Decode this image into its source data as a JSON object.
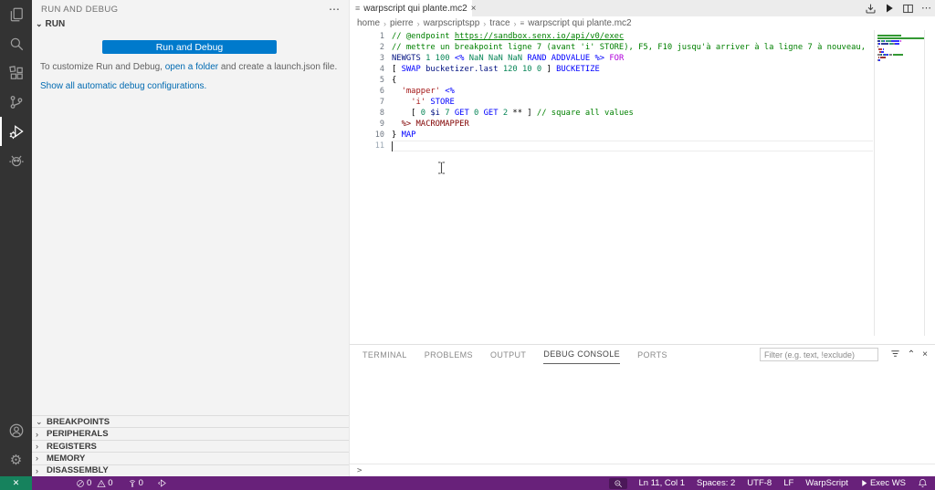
{
  "colors": {
    "accent": "#007acc",
    "statusbar": "#68217a",
    "remote": "#16825d",
    "comment": "#008000",
    "keyword": "#0000ff",
    "control": "#af00db",
    "variable": "#001080",
    "number": "#098658",
    "string": "#a31515",
    "macro": "#800000",
    "default": "#000000"
  },
  "icons": {
    "more": "⋯",
    "close": "×",
    "chevron_down": "⌄",
    "chevron_right": "›",
    "breadcrumb_sep": "›",
    "file": "≡",
    "collapse_up": "⌃",
    "remote": "✕",
    "gear": "⚙"
  },
  "activity_bar": {
    "items": [
      "explorer",
      "search",
      "extensions",
      "source-control",
      "run-and-debug",
      "debug-alt"
    ],
    "active": "run-and-debug",
    "bottom_items": [
      "accounts",
      "settings"
    ]
  },
  "sidebar": {
    "title": "RUN AND DEBUG",
    "run_label": "RUN",
    "button_label": "Run and Debug",
    "customize_pre": "To customize Run and Debug, ",
    "open_folder_link": "open a folder",
    "customize_post": " and create a launch.json file.",
    "show_configs_link": "Show all automatic debug configurations.",
    "sections": [
      "BREAKPOINTS",
      "PERIPHERALS",
      "REGISTERS",
      "MEMORY",
      "DISASSEMBLY"
    ]
  },
  "editor": {
    "tab": {
      "label": "warpscript qui plante.mc2"
    },
    "breadcrumb": [
      "home",
      "pierre",
      "warpscriptspp",
      "trace",
      "warpscript qui plante.mc2"
    ],
    "actions": [
      "run-or-debug",
      "run",
      "split-editor",
      "more-actions"
    ],
    "cursor": {
      "line": 11,
      "col": 1
    },
    "lines": [
      [
        [
          "c",
          "// @endpoint "
        ],
        [
          "cu",
          "https://sandbox.senx.io/api/v0/exec"
        ]
      ],
      [
        [
          "c",
          "// mettre un breakpoint ligne 7 (avant 'i' STORE), F5, F10 jusqu'à arriver à la ligne 7 à nouveau,"
        ]
      ],
      [
        [
          "v",
          "NEWGTS"
        ],
        [
          "d",
          " "
        ],
        [
          "n",
          "1 100"
        ],
        [
          "d",
          " "
        ],
        [
          "k",
          "<%"
        ],
        [
          "d",
          " "
        ],
        [
          "n",
          "NaN NaN NaN"
        ],
        [
          "d",
          " "
        ],
        [
          "k",
          "RAND ADDVALUE"
        ],
        [
          "d",
          " "
        ],
        [
          "k",
          "%>"
        ],
        [
          "d",
          " "
        ],
        [
          "f",
          "FOR"
        ]
      ],
      [
        [
          "d",
          "[ "
        ],
        [
          "k",
          "SWAP"
        ],
        [
          "d",
          " "
        ],
        [
          "v",
          "bucketizer.last"
        ],
        [
          "d",
          " "
        ],
        [
          "n",
          "120 10 0"
        ],
        [
          "d",
          " ] "
        ],
        [
          "k",
          "BUCKETIZE"
        ]
      ],
      [
        [
          "d",
          "{"
        ]
      ],
      [
        [
          "d",
          "  "
        ],
        [
          "s",
          "'mapper'"
        ],
        [
          "d",
          " "
        ],
        [
          "k",
          "<%"
        ]
      ],
      [
        [
          "d",
          "    "
        ],
        [
          "s",
          "'i'"
        ],
        [
          "d",
          " "
        ],
        [
          "k",
          "STORE"
        ]
      ],
      [
        [
          "d",
          "    [ "
        ],
        [
          "n",
          "0"
        ],
        [
          "d",
          " "
        ],
        [
          "v",
          "$i"
        ],
        [
          "d",
          " "
        ],
        [
          "n",
          "7"
        ],
        [
          "d",
          " "
        ],
        [
          "k",
          "GET"
        ],
        [
          "d",
          " "
        ],
        [
          "n",
          "0"
        ],
        [
          "d",
          " "
        ],
        [
          "k",
          "GET"
        ],
        [
          "d",
          " "
        ],
        [
          "n",
          "2"
        ],
        [
          "d",
          " ** ] "
        ],
        [
          "c",
          "// square all values"
        ]
      ],
      [
        [
          "d",
          "  "
        ],
        [
          "m",
          "%>"
        ],
        [
          "d",
          " "
        ],
        [
          "m",
          "MACROMAPPER"
        ]
      ],
      [
        [
          "d",
          "} "
        ],
        [
          "k",
          "MAP"
        ]
      ],
      []
    ]
  },
  "panel": {
    "tabs": [
      "TERMINAL",
      "PROBLEMS",
      "OUTPUT",
      "DEBUG CONSOLE",
      "PORTS"
    ],
    "active_tab": "DEBUG CONSOLE",
    "filter_placeholder": "Filter (e.g. text, !exclude)",
    "prompt": ">"
  },
  "status_bar": {
    "errors": "0",
    "warnings": "0",
    "broadcast_count": "0",
    "line_col": "Ln 11, Col 1",
    "indentation": "Spaces: 2",
    "encoding": "UTF-8",
    "eol": "LF",
    "language_mode": "WarpScript",
    "exec_button": "Exec WS"
  }
}
